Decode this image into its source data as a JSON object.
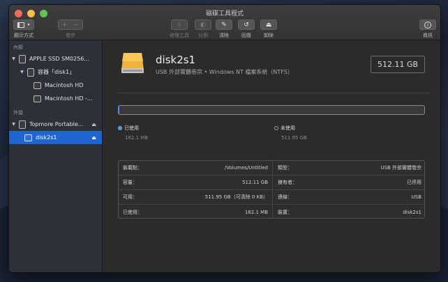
{
  "window": {
    "title": "磁碟工具程式"
  },
  "toolbar": {
    "view_label": "顯示方式",
    "volume_label": "卷宗",
    "first_aid_label": "修理工具",
    "partition_label": "分割",
    "erase_label": "清除",
    "restore_label": "回復",
    "unmount_label": "卸除",
    "info_label": "資訊"
  },
  "sidebar": {
    "internal_header": "內部",
    "external_header": "外接",
    "items": [
      {
        "label": "APPLE SSD SM0256..."
      },
      {
        "label": "容器「disk1」"
      },
      {
        "label": "Macintosh HD"
      },
      {
        "label": "Macintosh HD -..."
      },
      {
        "label": "Topmore Portable..."
      },
      {
        "label": "disk2s1"
      }
    ]
  },
  "volume": {
    "name": "disk2s1",
    "subtitle": "USB 外部實體卷宗 • Windows NT 檔案系統（NTFS）",
    "capacity": "512.11 GB"
  },
  "usage": {
    "used_label": "已使用",
    "used_value": "162.1 MB",
    "free_label": "未使用",
    "free_value": "511.95 GB",
    "used_fraction": 0.0003,
    "used_color": "#4a90d9"
  },
  "info": {
    "left": [
      {
        "key": "裝載點：",
        "value": "/Volumes/Untitled"
      },
      {
        "key": "容量：",
        "value": "512.11 GB"
      },
      {
        "key": "可用：",
        "value": "511.95 GB（可清除 0 KB）"
      },
      {
        "key": "已使用：",
        "value": "162.1 MB"
      }
    ],
    "right": [
      {
        "key": "類型：",
        "value": "USB 外部實體卷宗"
      },
      {
        "key": "擁有者：",
        "value": "已停用"
      },
      {
        "key": "連線：",
        "value": "USB"
      },
      {
        "key": "裝置：",
        "value": "disk2s1"
      }
    ]
  }
}
